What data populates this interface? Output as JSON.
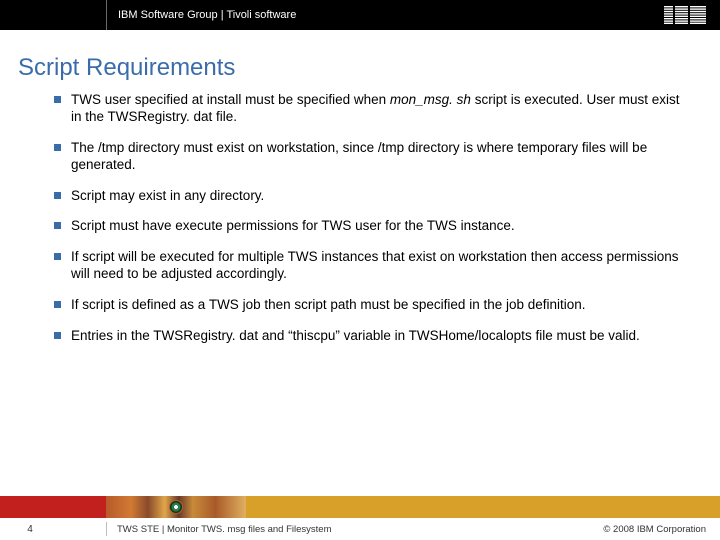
{
  "header": {
    "group": "IBM Software Group",
    "divider": "  |  ",
    "product": "Tivoli software"
  },
  "title": "Script Requirements",
  "bullets": [
    {
      "pre": "TWS user specified at install must be specified when ",
      "ital": "mon_msg. sh ",
      "post": "script is executed. User must exist in the TWSRegistry. dat file."
    },
    {
      "pre": "The /tmp directory must exist on workstation, since /tmp directory is where temporary files will be generated.",
      "ital": "",
      "post": ""
    },
    {
      "pre": "Script may exist in any directory.",
      "ital": "",
      "post": ""
    },
    {
      "pre": "Script must have execute permissions for TWS user for the TWS instance.",
      "ital": "",
      "post": ""
    },
    {
      "pre": "If script will be executed for multiple TWS instances that exist on workstation then access permissions will need to be adjusted accordingly.",
      "ital": "",
      "post": ""
    },
    {
      "pre": "If script is defined as a TWS job then script path must be specified in the job definition.",
      "ital": "",
      "post": ""
    },
    {
      "pre": "Entries in the TWSRegistry. dat and “thiscpu” variable in TWSHome/localopts file must be valid.",
      "ital": "",
      "post": ""
    }
  ],
  "footer": {
    "slide_number": "4",
    "line": "TWS STE | Monitor TWS. msg files and Filesystem",
    "copyright": "© 2008 IBM Corporation"
  }
}
